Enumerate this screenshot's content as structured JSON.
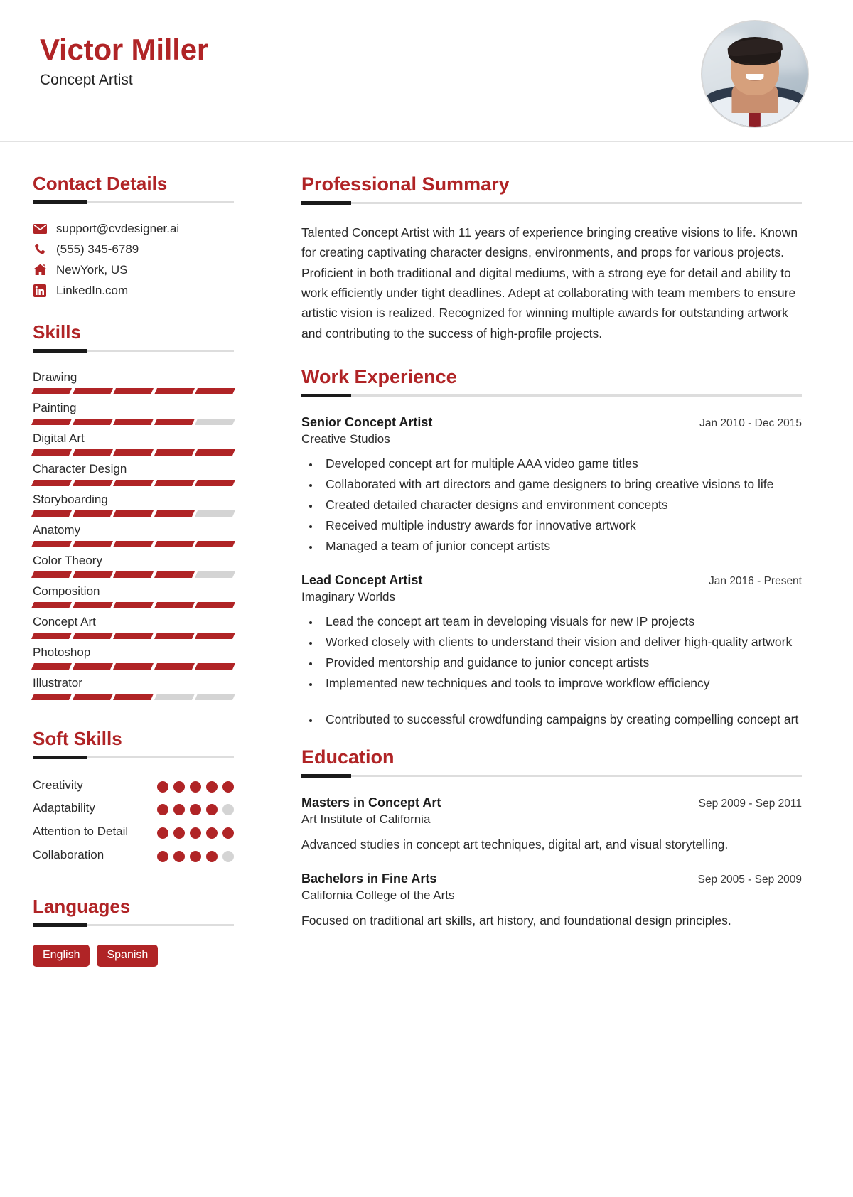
{
  "header": {
    "name": "Victor Miller",
    "job_title": "Concept Artist",
    "avatar_alt": "profile-photo",
    "accent_color": "#b02426"
  },
  "sidebar": {
    "contact": {
      "heading": "Contact Details",
      "items": [
        {
          "icon": "envelope-icon",
          "value": "support@cvdesigner.ai"
        },
        {
          "icon": "phone-icon",
          "value": "(555) 345-6789"
        },
        {
          "icon": "home-icon",
          "value": "NewYork, US"
        },
        {
          "icon": "linkedin-icon",
          "value": "LinkedIn.com"
        }
      ]
    },
    "skills": {
      "heading": "Skills",
      "max": 5,
      "items": [
        {
          "name": "Drawing",
          "level": 5
        },
        {
          "name": "Painting",
          "level": 4
        },
        {
          "name": "Digital Art",
          "level": 5
        },
        {
          "name": "Character Design",
          "level": 5
        },
        {
          "name": "Storyboarding",
          "level": 4
        },
        {
          "name": "Anatomy",
          "level": 5
        },
        {
          "name": "Color Theory",
          "level": 4
        },
        {
          "name": "Composition",
          "level": 5
        },
        {
          "name": "Concept Art",
          "level": 5
        },
        {
          "name": "Photoshop",
          "level": 5
        },
        {
          "name": "Illustrator",
          "level": 3
        }
      ]
    },
    "soft_skills": {
      "heading": "Soft Skills",
      "max": 5,
      "items": [
        {
          "name": "Creativity",
          "level": 5
        },
        {
          "name": "Adaptability",
          "level": 4
        },
        {
          "name": "Attention to Detail",
          "level": 5
        },
        {
          "name": "Collaboration",
          "level": 4
        }
      ]
    },
    "languages": {
      "heading": "Languages",
      "items": [
        "English",
        "Spanish"
      ]
    }
  },
  "main": {
    "summary": {
      "heading": "Professional Summary",
      "text": "Talented Concept Artist with 11 years of experience bringing creative visions to life. Known for creating captivating character designs, environments, and props for various projects. Proficient in both traditional and digital mediums, with a strong eye for detail and ability to work efficiently under tight deadlines. Adept at collaborating with team members to ensure artistic vision is realized. Recognized for winning multiple awards for outstanding artwork and contributing to the success of high-profile projects."
    },
    "work": {
      "heading": "Work Experience",
      "entries": [
        {
          "title": "Senior Concept Artist",
          "date": "Jan 2010 - Dec 2015",
          "org": "Creative Studios",
          "bullets": [
            "Developed concept art for multiple AAA video game titles",
            "Collaborated with art directors and game designers to bring creative visions to life",
            "Created detailed character designs and environment concepts",
            "Received multiple industry awards for innovative artwork",
            "Managed a team of junior concept artists"
          ]
        },
        {
          "title": "Lead Concept Artist",
          "date": "Jan 2016 - Present",
          "org": "Imaginary Worlds",
          "bullets": [
            "Lead the concept art team in developing visuals for new IP projects",
            "Worked closely with clients to understand their vision and deliver high-quality artwork",
            "Provided mentorship and guidance to junior concept artists",
            "Implemented new techniques and tools to improve workflow efficiency"
          ],
          "extra_bullets": [
            "Contributed to successful crowdfunding campaigns by creating compelling concept art"
          ]
        }
      ]
    },
    "education": {
      "heading": "Education",
      "entries": [
        {
          "title": "Masters in Concept Art",
          "date": "Sep 2009 - Sep 2011",
          "org": "Art Institute of California",
          "desc": "Advanced studies in concept art techniques, digital art, and visual storytelling."
        },
        {
          "title": "Bachelors in Fine Arts",
          "date": "Sep 2005 - Sep 2009",
          "org": "California College of the Arts",
          "desc": "Focused on traditional art skills, art history, and foundational design principles."
        }
      ]
    }
  }
}
